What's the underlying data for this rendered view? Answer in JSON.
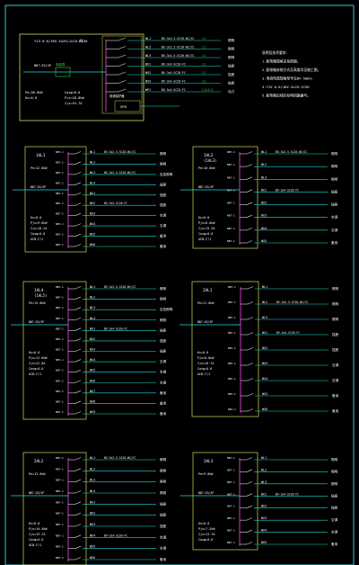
{
  "palette": {
    "background": "#000000",
    "frame": "#3cc8dc",
    "box": "#d8d860",
    "feeder": "#18e0d8",
    "breaker": "#e0e0e0",
    "label": "#ffffff",
    "magenta": "#e040e0",
    "green": "#30d040",
    "red": "#e04040"
  },
  "notes": {
    "lines": [
      "说明及技术要求:",
      "1.配电箱规格见系统图，",
      "2.配电箱安装方式及高度详见施工图，",
      "3.电线电缆规格型号见BV-500V，",
      "4.YJV-0.6/1KV-5x25-SC50",
      "5.配电箱出线应标明回路编号。"
    ]
  },
  "top_panel": {
    "incoming": "YJV-0.6/1KV-4x25+1x16-SC50",
    "panel_label": "AL",
    "main_breaker": "NB7-63/3P",
    "info": [
      "Pe=36.0kW",
      "Kx=0.8",
      "Cosφ=0.8",
      "Pjs=28.8kW",
      "Ijs=54.7A"
    ],
    "spd": "SPD",
    "surge_label": "电涌保护器",
    "meter_label": "电能表",
    "circuits": [
      {
        "no": "WL1",
        "spec": "BV-3x2.5-SC20-WC/CC",
        "phase": "L1",
        "load": "照明"
      },
      {
        "no": "WL2",
        "spec": "BV-3x2.5-SC20-WC/CC",
        "phase": "L2",
        "load": "照明"
      },
      {
        "no": "WL3",
        "spec": "BV-3x2.5-SC20-WC/CC",
        "phase": "L3",
        "load": "照明"
      },
      {
        "no": "WX1",
        "spec": "BV-3x4-SC20-FC",
        "phase": "L1",
        "load": "插座"
      },
      {
        "no": "WX2",
        "spec": "BV-3x4-SC20-FC",
        "phase": "L2",
        "load": "插座"
      },
      {
        "no": "WX3",
        "spec": "BV-3x4-SC20-FC",
        "phase": "L3",
        "load": "插座"
      },
      {
        "no": "WP1",
        "spec": "BV-5x4-SC25-FC",
        "phase": "L1L2L3",
        "load": "动力"
      }
    ]
  },
  "sub_panels": [
    {
      "name": "1AL1",
      "sub": "",
      "incomer": "NB7-63/3P",
      "power": "Pe=12.0kW",
      "info": [
        "Kx=0.8",
        "Pjs=9.6kW",
        "Ijs=18.2A",
        "Cosφ=0.8",
        "ACB-F/1"
      ],
      "breaker": "NB7-16/1P",
      "circuits": [
        {
          "no": "WL1",
          "spec": "BV-3x2.5-SC20-WC/CC",
          "load": "照明"
        },
        {
          "no": "WL2",
          "spec": "",
          "load": "照明"
        },
        {
          "no": "WL3",
          "spec": "BV-3x2.5-SC20-WC/CC",
          "load": "应急照明"
        },
        {
          "no": "WL4",
          "spec": "",
          "load": "插座"
        },
        {
          "no": "WX1",
          "spec": "",
          "load": "插座"
        },
        {
          "no": "WX2",
          "spec": "BV-3x4-SC20-FC",
          "load": "插座"
        },
        {
          "no": "WX3",
          "spec": "",
          "load": "空调"
        },
        {
          "no": "WX4",
          "spec": "",
          "load": "空调"
        },
        {
          "no": "WX5",
          "spec": "",
          "load": "备用"
        },
        {
          "no": "WX6",
          "spec": "",
          "load": "备用"
        }
      ]
    },
    {
      "name": "1AL2",
      "sub": "(1AL3)",
      "incomer": "NB7-63/3P",
      "power": "Pe=10.0kW",
      "info": [
        "Kx=0.8",
        "Pjs=8.0kW",
        "Ijs=15.2A",
        "Cosφ=0.8",
        "ACB-F/1"
      ],
      "breaker": "NB7-16/1P",
      "circuits": [
        {
          "no": "WL1",
          "spec": "BV-3x2.5-SC20-WC/CC",
          "load": "照明"
        },
        {
          "no": "WL2",
          "spec": "",
          "load": "照明"
        },
        {
          "no": "WL3",
          "spec": "",
          "load": "照明"
        },
        {
          "no": "WX1",
          "spec": "BV-3x4-SC20-FC",
          "load": "插座"
        },
        {
          "no": "WX2",
          "spec": "",
          "load": "插座"
        },
        {
          "no": "WX3",
          "spec": "",
          "load": "空调"
        },
        {
          "no": "WX4",
          "spec": "",
          "load": "空调"
        },
        {
          "no": "WX5",
          "spec": "",
          "load": "备用"
        }
      ]
    },
    {
      "name": "1AL4",
      "sub": "(1AL5)",
      "incomer": "NB7-63/3P",
      "power": "Pe=15.0kW",
      "info": [
        "Kx=0.8",
        "Pjs=12.0kW",
        "Ijs=22.8A",
        "Cosφ=0.8",
        "ACB-F/1"
      ],
      "breaker": "NB7-16/1P",
      "circuits": [
        {
          "no": "WL1",
          "spec": "BV-3x2.5-SC20-WC/CC",
          "load": "照明"
        },
        {
          "no": "WL2",
          "spec": "",
          "load": "照明"
        },
        {
          "no": "WL3",
          "spec": "",
          "load": "应急照明"
        },
        {
          "no": "WL4",
          "spec": "",
          "load": "照明"
        },
        {
          "no": "WX1",
          "spec": "BV-3x4-SC20-FC",
          "load": "插座"
        },
        {
          "no": "WX2",
          "spec": "",
          "load": "插座"
        },
        {
          "no": "WX3",
          "spec": "",
          "load": "插座"
        },
        {
          "no": "WX4",
          "spec": "",
          "load": "空调"
        },
        {
          "no": "WX5",
          "spec": "",
          "load": "空调"
        },
        {
          "no": "WX6",
          "spec": "",
          "load": "空调"
        },
        {
          "no": "WX7",
          "spec": "",
          "load": "备用"
        },
        {
          "no": "WX8",
          "spec": "",
          "load": "备用"
        },
        {
          "no": "WX9",
          "spec": "",
          "load": "备用"
        }
      ]
    },
    {
      "name": "2AL1",
      "sub": "",
      "incomer": "NB7-63/3P",
      "power": "Pe=11.0kW",
      "info": [
        "Kx=0.8",
        "Pjs=8.8kW",
        "Ijs=16.7A",
        "Cosφ=0.8",
        "ACB-F/1"
      ],
      "breaker": "NB7-16/1P",
      "circuits": [
        {
          "no": "WL1",
          "spec": "",
          "load": "照明"
        },
        {
          "no": "WL2",
          "spec": "BV-3x2.5-SC20-WC/CC",
          "load": "照明"
        },
        {
          "no": "WL3",
          "spec": "",
          "load": "照明"
        },
        {
          "no": "WX1",
          "spec": "BV-3x4-SC20-FC",
          "load": "插座"
        },
        {
          "no": "WX2",
          "spec": "",
          "load": "插座"
        },
        {
          "no": "WX3",
          "spec": "",
          "load": "空调"
        },
        {
          "no": "WX4",
          "spec": "",
          "load": "空调"
        },
        {
          "no": "WX5",
          "spec": "",
          "load": "备用"
        },
        {
          "no": "WX6",
          "spec": "",
          "load": "备用"
        }
      ]
    },
    {
      "name": "2AL2",
      "sub": "",
      "incomer": "NB7-63/3P",
      "power": "Pe=13.0kW",
      "info": [
        "Kx=0.8",
        "Pjs=10.4kW",
        "Ijs=19.7A",
        "Cosφ=0.8",
        "ACB-F/1"
      ],
      "breaker": "NB7-16/1P",
      "circuits": [
        {
          "no": "WL1",
          "spec": "BV-3x2.5-SC20-WC/CC",
          "load": "照明"
        },
        {
          "no": "WL2",
          "spec": "",
          "load": "照明"
        },
        {
          "no": "WL3",
          "spec": "",
          "load": "照明"
        },
        {
          "no": "WL4",
          "spec": "",
          "load": "照明"
        },
        {
          "no": "WX1",
          "spec": "",
          "load": "插座"
        },
        {
          "no": "WX2",
          "spec": "",
          "load": "插座"
        },
        {
          "no": "WX3",
          "spec": "",
          "load": "插座"
        },
        {
          "no": "WX4",
          "spec": "BV-3x4-SC20-FC",
          "load": "空调"
        },
        {
          "no": "WX5",
          "spec": "",
          "load": "空调"
        },
        {
          "no": "WX6",
          "spec": "",
          "load": "备用"
        }
      ]
    },
    {
      "name": "2AL3",
      "sub": "",
      "incomer": "NB7-63/3P",
      "power": "Pe=9.0kW",
      "info": [
        "Kx=0.8",
        "Pjs=7.2kW",
        "Ijs=13.7A",
        "Cosφ=0.8"
      ],
      "breaker": "NB7-16/1P",
      "circuits": [
        {
          "no": "WL1",
          "spec": "",
          "load": "照明"
        },
        {
          "no": "WL2",
          "spec": "",
          "load": "照明"
        },
        {
          "no": "WL3",
          "spec": "",
          "load": "照明"
        },
        {
          "no": "WX1",
          "spec": "BV-3x4-SC20-FC",
          "load": "插座"
        },
        {
          "no": "WX2",
          "spec": "",
          "load": "插座"
        },
        {
          "no": "WX3",
          "spec": "",
          "load": "空调"
        },
        {
          "no": "WX4",
          "spec": "",
          "load": "空调"
        },
        {
          "no": "WX5",
          "spec": "",
          "load": "备用"
        }
      ]
    }
  ]
}
